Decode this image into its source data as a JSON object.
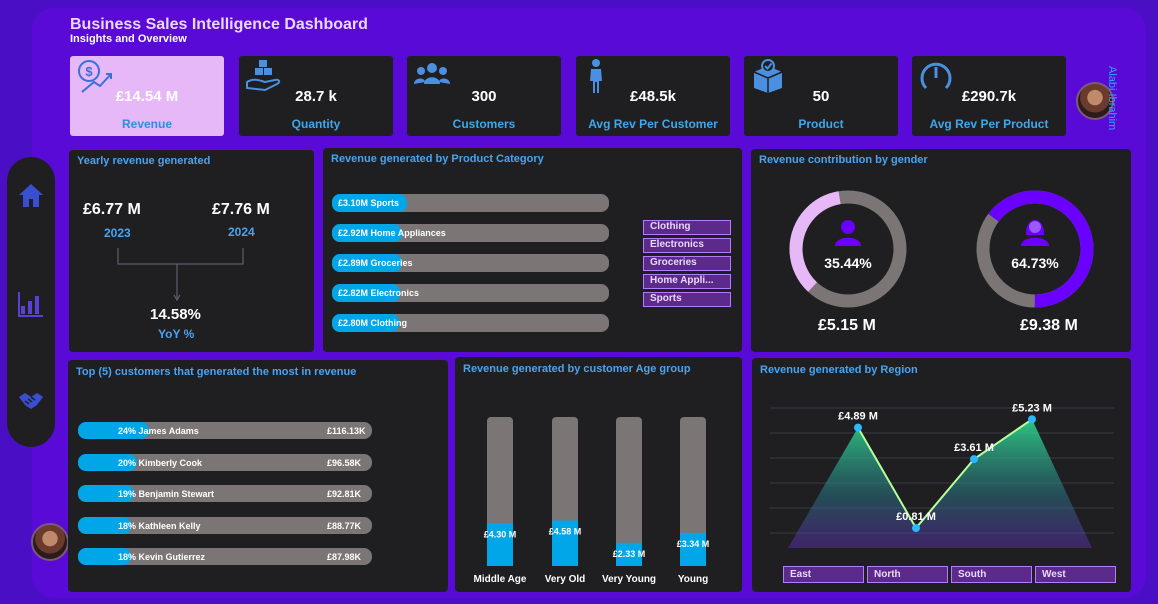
{
  "header": {
    "title": "Business Sales Intelligence Dashboard",
    "subtitle": "Insights and Overview",
    "user_name": "Alabi Ibrahim"
  },
  "kpis": [
    {
      "value": "£14.54 M",
      "label": "Revenue",
      "icon": "money-growth-icon",
      "active": true
    },
    {
      "value": "28.7 k",
      "label": "Quantity",
      "icon": "boxes-hand-icon"
    },
    {
      "value": "300",
      "label": "Customers",
      "icon": "people-icon"
    },
    {
      "value": "£48.5k",
      "label": "Avg Rev Per Customer",
      "icon": "person-icon"
    },
    {
      "value": "50",
      "label": "Product",
      "icon": "product-box-icon"
    },
    {
      "value": "£290.7k",
      "label": "Avg Rev Per Product",
      "icon": "gauge-icon"
    }
  ],
  "sidebar": {
    "icons": [
      "home-icon",
      "bar-chart-icon",
      "handshake-icon"
    ]
  },
  "yearly": {
    "title": "Yearly revenue generated",
    "y2023_value": "£6.77 M",
    "y2023_label": "2023",
    "y2024_value": "£7.76 M",
    "y2024_label": "2024",
    "yoy_value": "14.58%",
    "yoy_label": "YoY %"
  },
  "colors": {
    "accent_blue": "#00a6e8",
    "track_grey": "#7b7575",
    "panel": "#1f1f22",
    "female": "#6a00ff",
    "male": "#e6b8f7",
    "background": "#5a0ad6"
  },
  "chart_data": [
    {
      "type": "bar",
      "title": "Revenue generated by Product Category",
      "categories": [
        "Sports",
        "Home Appliances",
        "Groceries",
        "Electronics",
        "Clothing"
      ],
      "values": [
        3.1,
        2.92,
        2.89,
        2.82,
        2.8
      ],
      "labels": [
        "£3.10M",
        "£2.92M",
        "£2.89M",
        "£2.82M",
        "£2.80M"
      ],
      "slicer": [
        "Clothing",
        "Electronics",
        "Groceries",
        "Home Appli...",
        "Sports"
      ]
    },
    {
      "type": "pie",
      "title": "Revenue contribution by gender",
      "series": [
        {
          "name": "male-icon",
          "share": 35.44,
          "share_label": "35.44%",
          "value_label": "£5.15 M"
        },
        {
          "name": "female-icon",
          "share": 64.73,
          "share_label": "64.73%",
          "value_label": "£9.38 M"
        }
      ]
    },
    {
      "type": "bar",
      "title": "Top (5) customers that generated the most in revenue",
      "categories": [
        "James Adams",
        "Kimberly Cook",
        "Benjamin Stewart",
        "Kathleen Kelly",
        "Kevin Gutierrez"
      ],
      "values": [
        116.13,
        96.58,
        92.81,
        88.77,
        87.98
      ],
      "pct_labels": [
        "24%",
        "20%",
        "19%",
        "18%",
        "18%"
      ],
      "pcts": [
        24,
        20,
        19,
        18,
        18
      ],
      "value_labels": [
        "£116.13K",
        "£96.58K",
        "£92.81K",
        "£88.77K",
        "£87.98K"
      ]
    },
    {
      "type": "bar",
      "title": "Revenue generated by  customer Age group",
      "categories": [
        "Middle Age",
        "Very Old",
        "Very Young",
        "Young"
      ],
      "values": [
        4.3,
        4.58,
        2.33,
        3.34
      ],
      "labels": [
        "£4.30 M",
        "£4.58 M",
        "£2.33 M",
        "£3.34 M"
      ],
      "ylim": [
        0,
        15
      ]
    },
    {
      "type": "area",
      "title": "Revenue generated by Region",
      "categories": [
        "East",
        "North",
        "South",
        "West"
      ],
      "values": [
        4.89,
        0.81,
        3.61,
        5.23
      ],
      "labels": [
        "£4.89 M",
        "£0.81 M",
        "£3.61 M",
        "£5.23 M"
      ],
      "ylim": [
        0,
        6.5
      ]
    }
  ]
}
